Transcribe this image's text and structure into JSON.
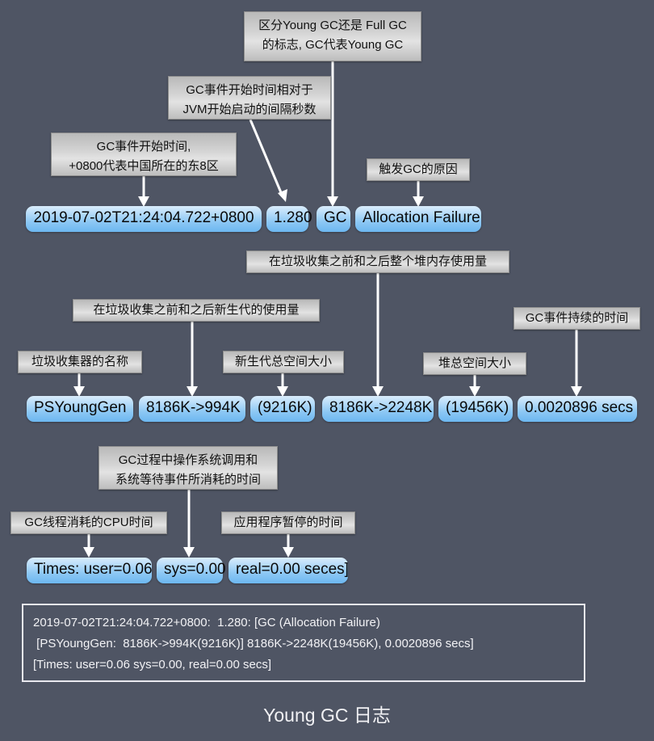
{
  "theme": {
    "background": "#4f5564",
    "note_bg": "#d6d6d6",
    "pill_bg": "#8cc7f4",
    "line_color": "#ffffff",
    "text_light": "#f2f2f5"
  },
  "notes": [
    {
      "id": "gc-type-note",
      "text": "区分Young GC还是 Full GC\n的标志, GC代表Young GC"
    },
    {
      "id": "relative-time-note",
      "text": "GC事件开始时间相对于\nJVM开始启动的间隔秒数"
    },
    {
      "id": "start-time-note",
      "text": "GC事件开始时间,\n+0800代表中国所在的东8区"
    },
    {
      "id": "gc-cause-note",
      "text": "触发GC的原因"
    },
    {
      "id": "heap-usage-note",
      "text": "在垃圾收集之前和之后整个堆内存使用量"
    },
    {
      "id": "young-usage-note",
      "text": "在垃圾收集之前和之后新生代的使用量"
    },
    {
      "id": "duration-note",
      "text": "GC事件持续的时间"
    },
    {
      "id": "collector-name-note",
      "text": "垃圾收集器的名称"
    },
    {
      "id": "young-total-note",
      "text": "新生代总空间大小"
    },
    {
      "id": "heap-total-note",
      "text": "堆总空间大小"
    },
    {
      "id": "sys-time-note",
      "text": "GC过程中操作系统调用和\n系统等待事件所消耗的时间"
    },
    {
      "id": "cpu-time-note",
      "text": "GC线程消耗的CPU时间"
    },
    {
      "id": "pause-time-note",
      "text": "应用程序暂停的时间"
    }
  ],
  "pills": {
    "row1": [
      {
        "id": "timestamp-pill",
        "text": "2019-07-02T21:24:04.722+0800"
      },
      {
        "id": "uptime-pill",
        "text": "1.280"
      },
      {
        "id": "gctype-pill",
        "text": "GC"
      },
      {
        "id": "gccause-pill",
        "text": "Allocation Failure"
      }
    ],
    "row2": [
      {
        "id": "collector-pill",
        "text": "PSYoungGen"
      },
      {
        "id": "young-delta-pill",
        "text": "8186K->994K"
      },
      {
        "id": "young-total-pill",
        "text": "(9216K)"
      },
      {
        "id": "heap-delta-pill",
        "text": "8186K->2248K"
      },
      {
        "id": "heap-total-pill",
        "text": "(19456K)"
      },
      {
        "id": "duration-pill",
        "text": "0.0020896 secs"
      }
    ],
    "row3": [
      {
        "id": "user-time-pill",
        "text": "Times: user=0.06"
      },
      {
        "id": "sys-time-pill",
        "text": "sys=0.00"
      },
      {
        "id": "real-time-pill",
        "text": "real=0.00 seces]"
      }
    ]
  },
  "log": {
    "line1": "2019-07-02T21:24:04.722+0800:  1.280: [GC (Allocation Failure)",
    "line2": " [PSYoungGen:  8186K->994K(9216K)] 8186K->2248K(19456K), 0.0020896 secs]",
    "line3": "[Times: user=0.06 sys=0.00, real=0.00 secs]"
  },
  "caption": "Young GC 日志"
}
